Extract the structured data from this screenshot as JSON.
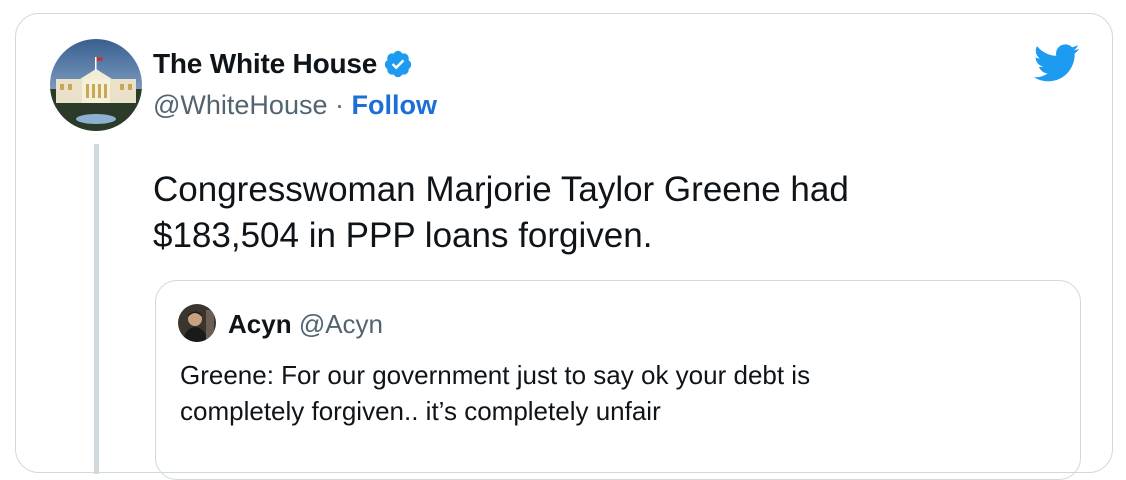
{
  "tweet": {
    "author": {
      "display_name": "The White House",
      "handle": "@WhiteHouse",
      "separator": "·",
      "follow_label": "Follow",
      "verified": true
    },
    "text_line1": "Congresswoman Marjorie Taylor Greene had",
    "text_line2": "$183,504 in PPP loans forgiven."
  },
  "quoted_tweet": {
    "author": {
      "display_name": "Acyn",
      "handle": "@Acyn"
    },
    "text_line1": "Greene: For our government just to say ok your debt is",
    "text_line2": "completely forgiven.. it’s completely unfair"
  },
  "icons": {
    "brand": "twitter-bird-icon",
    "verified": "verified-badge-icon"
  },
  "colors": {
    "brand_blue": "#1d9bf0",
    "link_blue": "#1d6fd6",
    "text": "#0f1419",
    "secondary_text": "#536471",
    "border": "#cfd9de"
  }
}
